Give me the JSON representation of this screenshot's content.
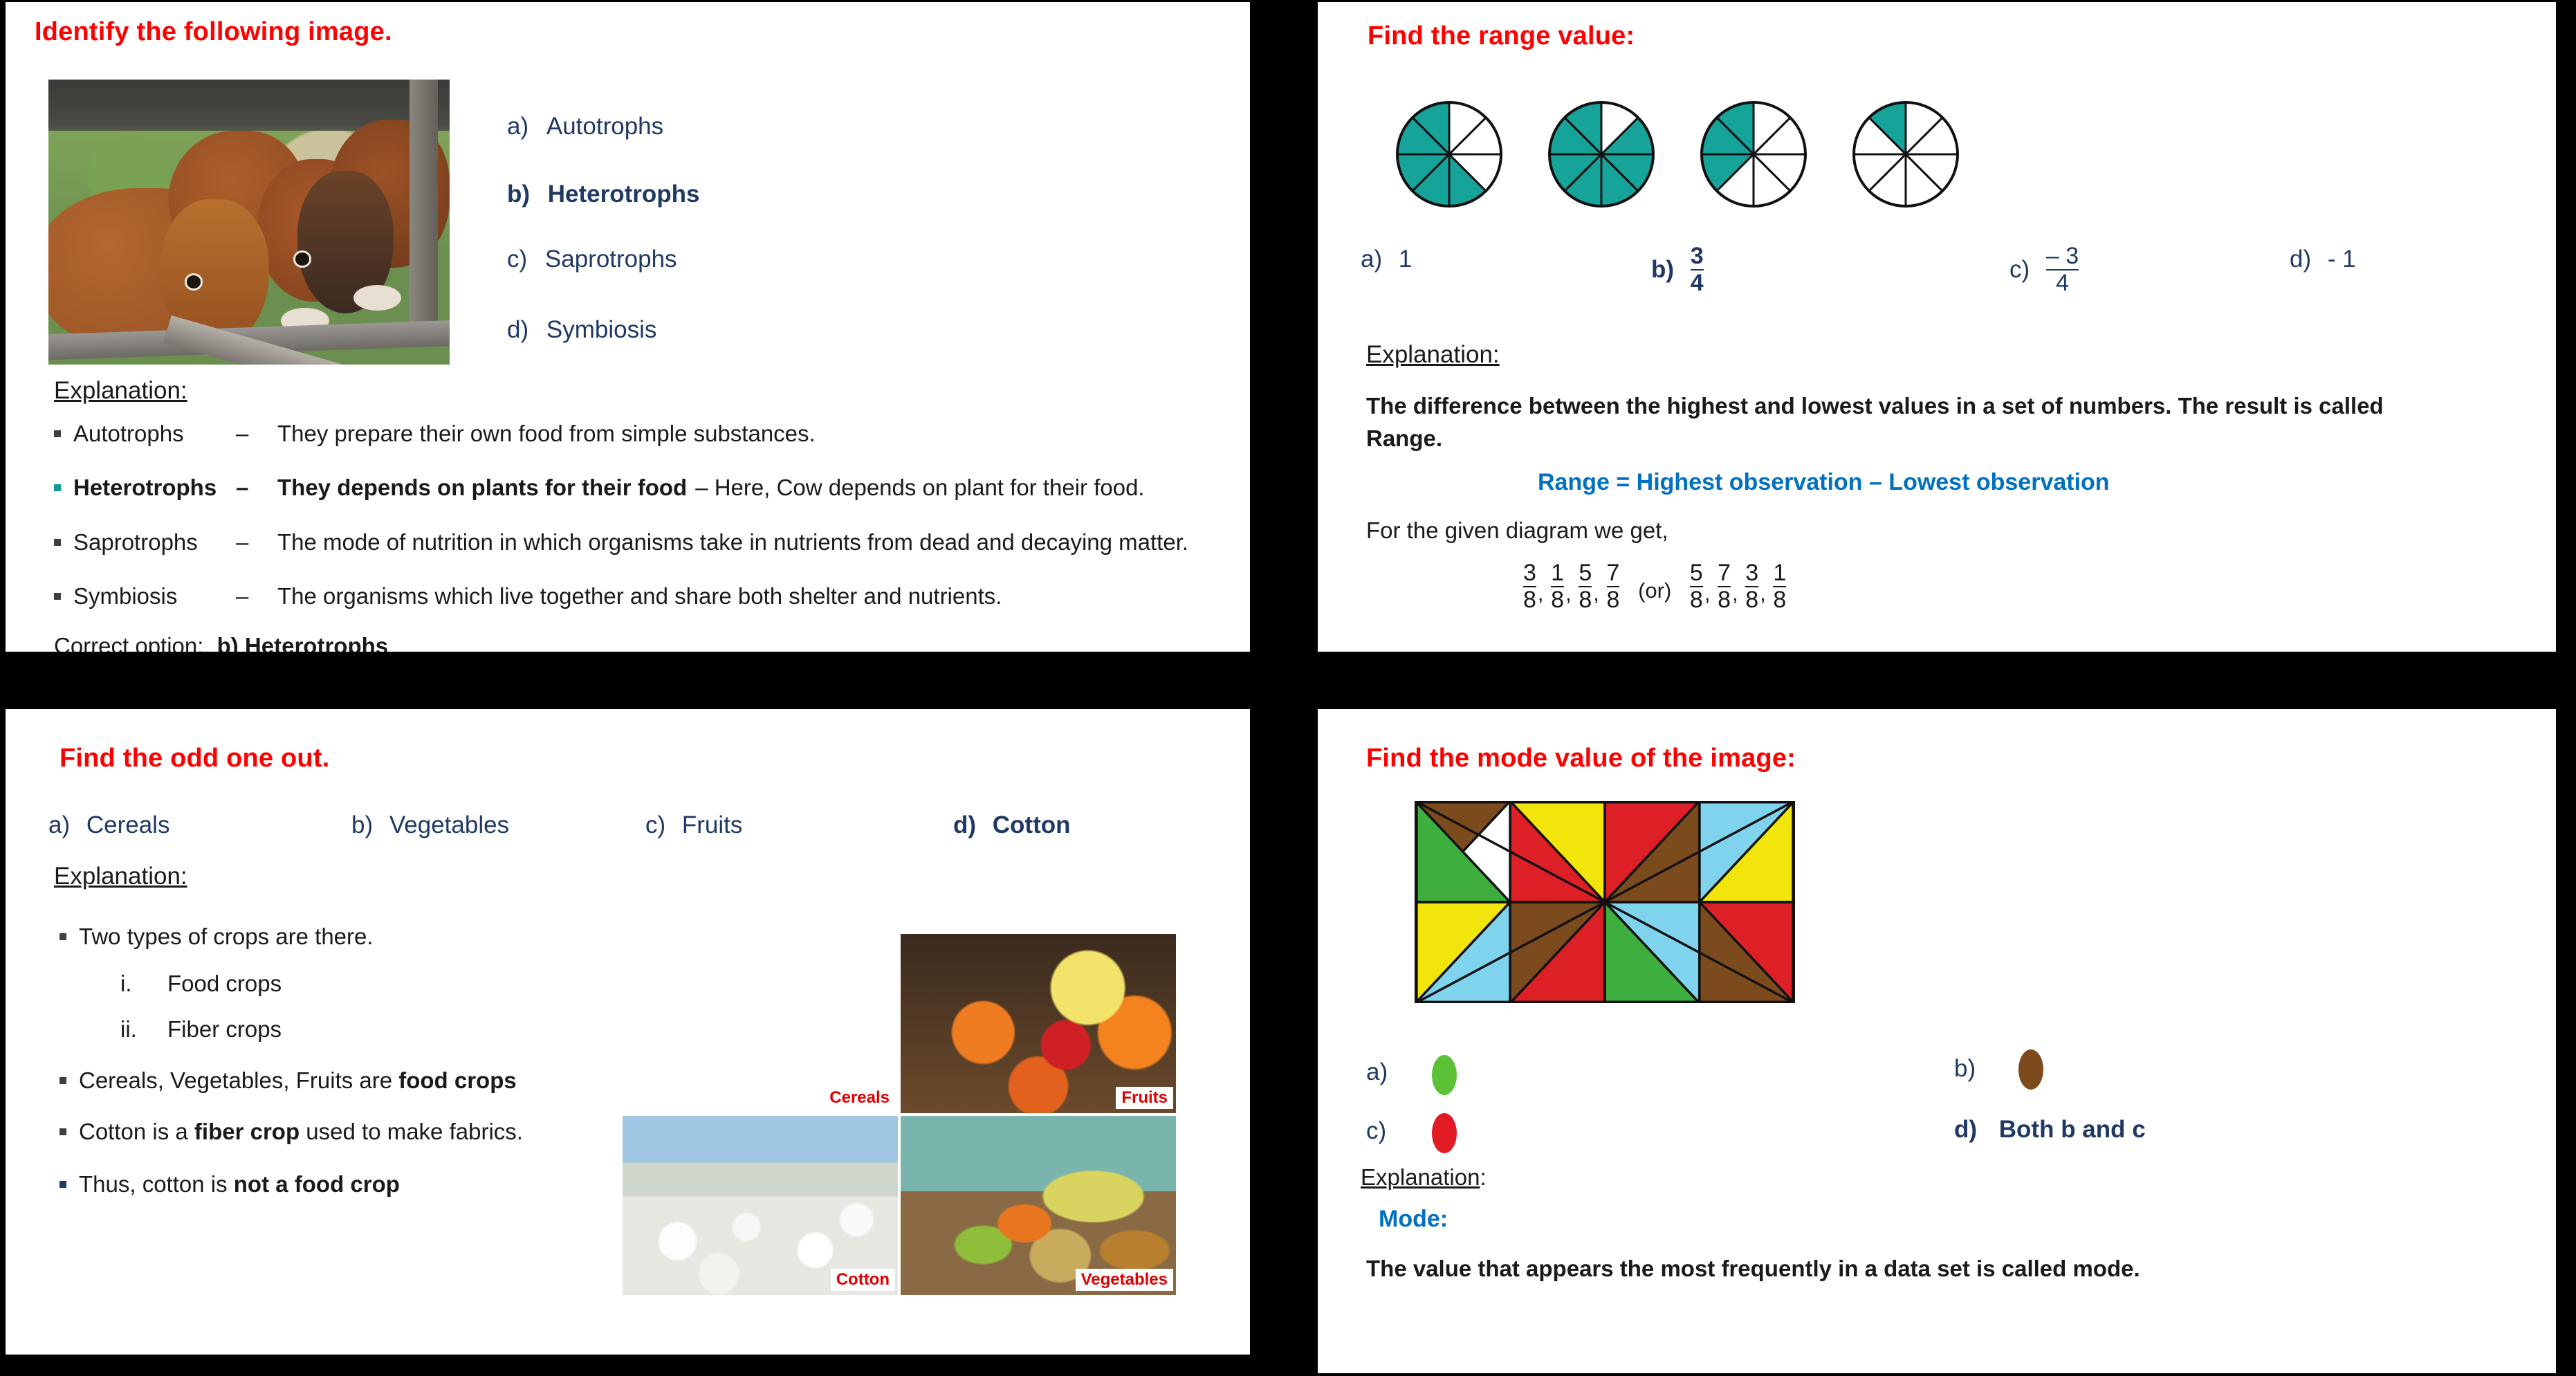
{
  "panels": {
    "identify_image": {
      "title": "Identify the following image.",
      "options": [
        {
          "key": "a)",
          "label": "Autotrophs",
          "bold": false
        },
        {
          "key": "b)",
          "label": "Heterotrophs",
          "bold": true
        },
        {
          "key": "c)",
          "label": "Saprotrophs",
          "bold": false
        },
        {
          "key": "d)",
          "label": "Symbiosis",
          "bold": false
        }
      ],
      "explanation_heading": "Explanation:",
      "bullets": [
        {
          "term": "Autotrophs",
          "dash": "–",
          "desc": "They prepare their own food from simple substances.",
          "highlight": false
        },
        {
          "term": "Heterotrophs",
          "dash": "–",
          "desc": "They depends on plants for their food",
          "tail": "– Here, Cow depends on plant for their food.",
          "highlight": true
        },
        {
          "term": "Saprotrophs",
          "dash": "–",
          "desc": "The mode of nutrition in which organisms take in nutrients from dead and decaying matter.",
          "highlight": false
        },
        {
          "term": "Symbiosis",
          "dash": "–",
          "desc": "The organisms which live together and share both shelter and nutrients.",
          "highlight": false
        }
      ],
      "correct_label": "Correct option:",
      "correct_value": "b) Heterotrophs",
      "image_alt": "cows-at-fence-photo"
    },
    "range_value": {
      "title": "Find the range value:",
      "options": [
        {
          "key": "a)",
          "value": "1",
          "type": "plain",
          "bold": false
        },
        {
          "key": "b)",
          "num": "3",
          "den": "4",
          "type": "fraction",
          "bold": true
        },
        {
          "key": "c)",
          "num": "– 3",
          "den": "4",
          "type": "fraction",
          "bold": false
        },
        {
          "key": "d)",
          "value": "- 1",
          "type": "plain",
          "bold": false
        }
      ],
      "explanation_heading": "Explanation:",
      "definition_line1": "The difference between the highest and lowest values in a set of numbers. The result is called",
      "definition_line2": "Range.",
      "formula": "Range = Highest observation – Lowest observation",
      "given_line": "For the given diagram we get,",
      "fraction_set_a": [
        "3/8",
        "1/8",
        "5/8",
        "7/8"
      ],
      "connector": "(or)",
      "fraction_set_b": [
        "5/8",
        "7/8",
        "3/8",
        "1/8"
      ]
    },
    "odd_one_out": {
      "title": "Find the odd one out.",
      "options": [
        {
          "key": "a)",
          "label": "Cereals",
          "bold": false
        },
        {
          "key": "b)",
          "label": "Vegetables",
          "bold": false
        },
        {
          "key": "c)",
          "label": "Fruits",
          "bold": false
        },
        {
          "key": "d)",
          "label": "Cotton",
          "bold": true
        }
      ],
      "explanation_heading": "Explanation:",
      "bullets": [
        {
          "text": "Two types of crops are there.",
          "level": 1,
          "bold_part": "",
          "highlight": false
        },
        {
          "text": "Food crops",
          "level": 2,
          "marker": "i.",
          "highlight": false
        },
        {
          "text": "Fiber crops",
          "level": 2,
          "marker": "ii.",
          "highlight": false
        },
        {
          "text": "Cereals, Vegetables, Fruits are ",
          "bold_part": "food crops",
          "level": 1,
          "highlight": false
        },
        {
          "text": "Cotton is a ",
          "bold_part": "fiber crop",
          "tail": " used to make fabrics.",
          "level": 1,
          "highlight": false
        },
        {
          "text": "Thus, cotton is ",
          "bold_part": "not a food crop",
          "level": 1,
          "highlight": true
        }
      ],
      "photos": [
        {
          "caption": "Cereals",
          "name": "cereals-photo"
        },
        {
          "caption": "Fruits",
          "name": "fruits-photo"
        },
        {
          "caption": "Cotton",
          "name": "cotton-photo"
        },
        {
          "caption": "Vegetables",
          "name": "vegetables-photo"
        }
      ]
    },
    "mode_value": {
      "title": "Find the mode value of the image:",
      "options": [
        {
          "key": "a)",
          "swatch": "#5BC236",
          "label": "",
          "bold": false
        },
        {
          "key": "b)",
          "swatch": "#7B4B1E",
          "label": "",
          "bold": false
        },
        {
          "key": "c)",
          "swatch": "#E01B24",
          "label": "",
          "bold": false
        },
        {
          "key": "d)",
          "swatch": "",
          "label": "Both b and c",
          "bold": true
        }
      ],
      "explanation_heading": "Explanation",
      "explanation_colon": ":",
      "mode_label": "Mode:",
      "mode_definition": "The value that appears the most frequently in a data set is called mode."
    }
  },
  "colors": {
    "title_red": "#FF0000",
    "option_blue": "#1F3864",
    "teal": "#0F9B8E",
    "formula_blue": "#0070C0",
    "mode_green": "#5BC236",
    "mode_brown": "#7B4B1E",
    "mode_red": "#E01B24",
    "mode_yellow": "#F2E50B",
    "mode_skyblue": "#7FD3EC",
    "pie_teal": "#16A39A"
  },
  "chart_data": [
    {
      "type": "pie",
      "name": "range-fraction-circles",
      "title": "Find the range value:",
      "slices_per_circle": 8,
      "circles": [
        {
          "index": 1,
          "shaded": 5,
          "total": 8,
          "fraction": "5/8"
        },
        {
          "index": 2,
          "shaded": 7,
          "total": 8,
          "fraction": "7/8"
        },
        {
          "index": 3,
          "shaded": 3,
          "total": 8,
          "fraction": "3/8"
        },
        {
          "index": 4,
          "shaded": 1,
          "total": 8,
          "fraction": "1/8"
        }
      ],
      "shaded_color": "#16A39A",
      "unshaded_color": "#FFFFFF",
      "range_answer": "3/4"
    },
    {
      "type": "heatmap",
      "name": "mode-color-grid",
      "title": "Find the mode value of the image:",
      "rows": 2,
      "cols": 4,
      "cell_split": "diagonal",
      "legend": [
        "green",
        "brown",
        "yellow",
        "red",
        "skyblue"
      ],
      "cells": [
        {
          "row": 1,
          "col": 1,
          "upper": "brown",
          "lower": "green"
        },
        {
          "row": 1,
          "col": 2,
          "upper": "yellow",
          "lower": "red"
        },
        {
          "row": 1,
          "col": 3,
          "upper": "red",
          "lower": "brown"
        },
        {
          "row": 1,
          "col": 4,
          "upper": "skyblue",
          "lower": "yellow"
        },
        {
          "row": 2,
          "col": 1,
          "upper": "yellow",
          "lower": "skyblue"
        },
        {
          "row": 2,
          "col": 2,
          "upper": "brown",
          "lower": "red"
        },
        {
          "row": 2,
          "col": 3,
          "upper": "skyblue",
          "lower": "green"
        },
        {
          "row": 2,
          "col": 4,
          "upper": "red",
          "lower": "brown"
        }
      ],
      "counts": {
        "red": 4,
        "brown": 4,
        "yellow": 3,
        "green": 3,
        "skyblue": 3
      },
      "mode_answer": "Both b and c"
    }
  ]
}
